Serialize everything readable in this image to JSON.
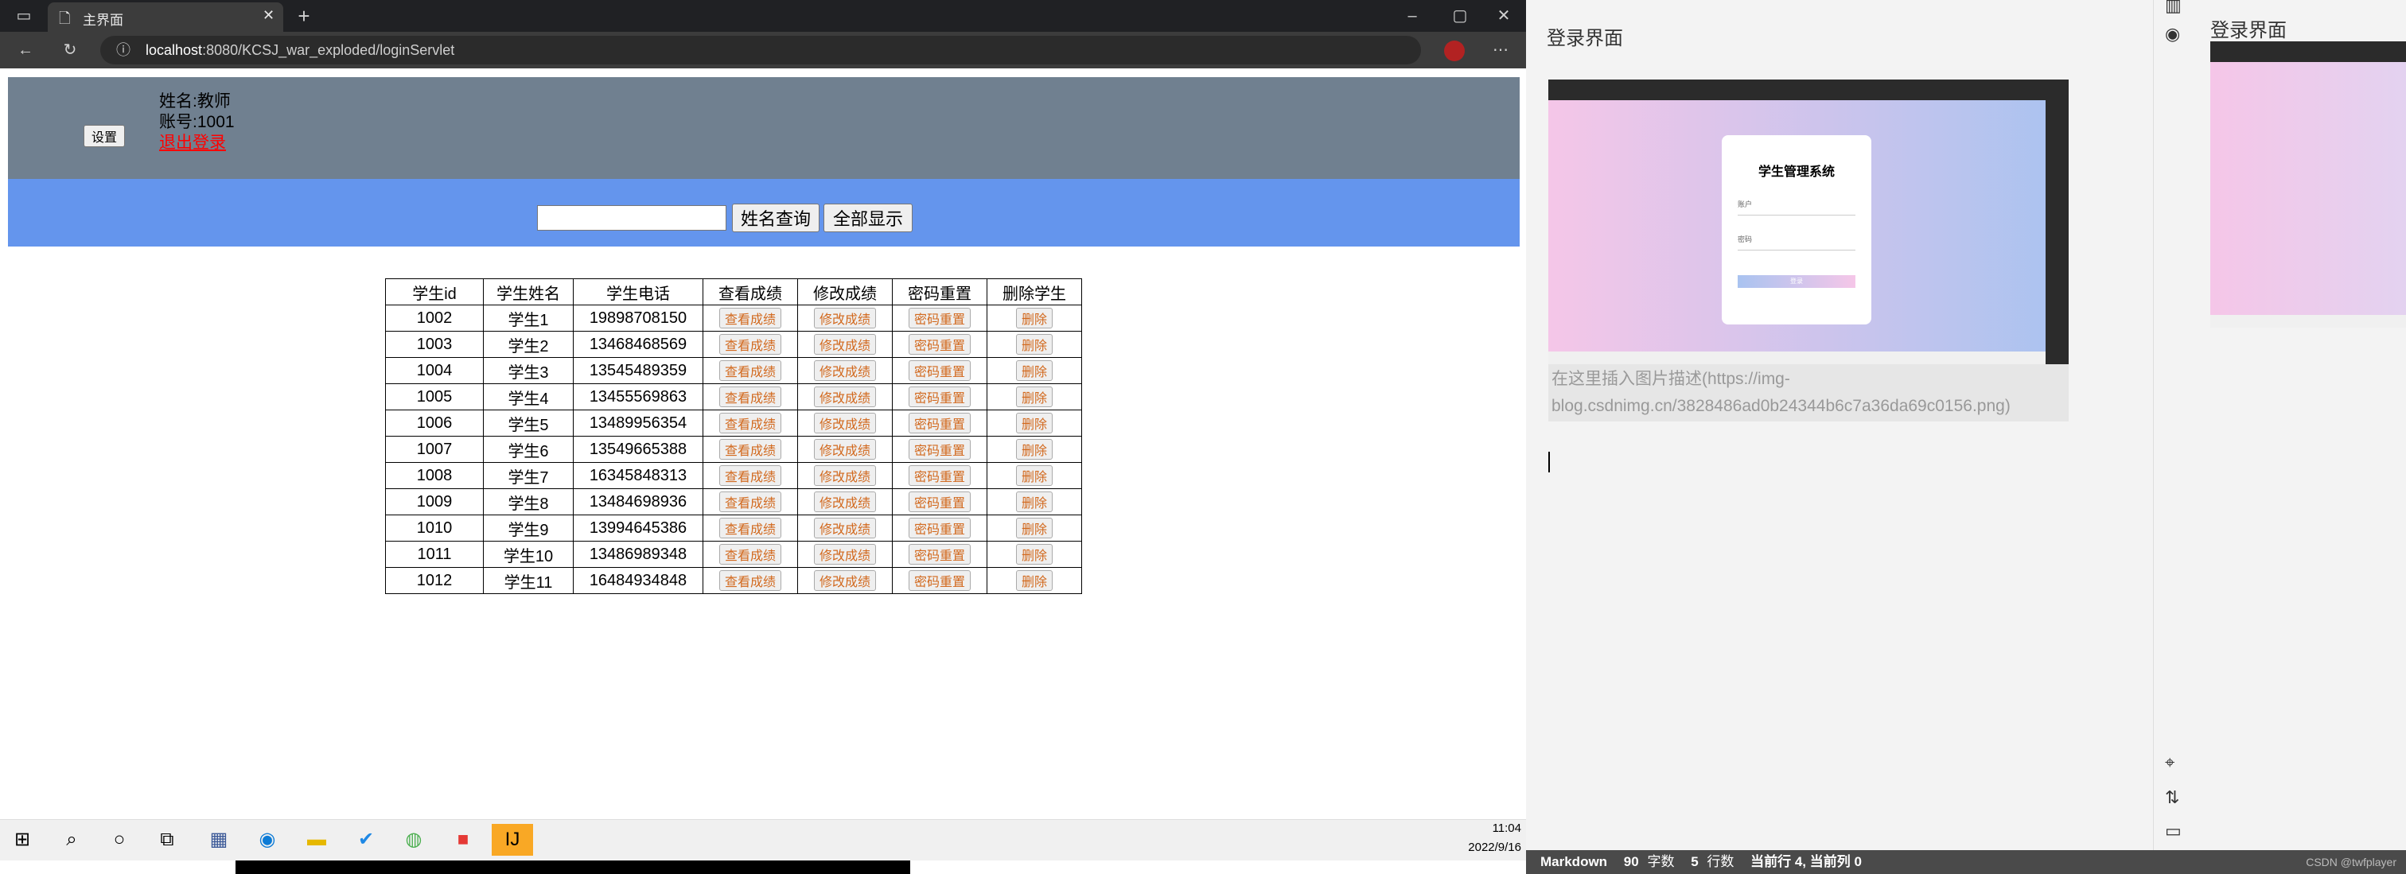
{
  "browser": {
    "tab_title": "主界面",
    "url_host": "localhost",
    "url_rest": ":8080/KCSJ_war_exploded/loginServlet"
  },
  "page": {
    "settings_button": "设置",
    "user_name": "姓名:教师",
    "user_account": "账号:1001",
    "logout_link": "退出登录",
    "search_input_value": "",
    "search_button": "姓名查询",
    "show_all_button": "全部显示",
    "table": {
      "headers": [
        "学生id",
        "学生姓名",
        "学生电话",
        "查看成绩",
        "修改成绩",
        "密码重置",
        "删除学生"
      ],
      "rows": [
        [
          "1002",
          "学生1",
          "19898708150"
        ],
        [
          "1003",
          "学生2",
          "13468468569"
        ],
        [
          "1004",
          "学生3",
          "13545489359"
        ],
        [
          "1005",
          "学生4",
          "13455569863"
        ],
        [
          "1006",
          "学生5",
          "13489956354"
        ],
        [
          "1007",
          "学生6",
          "13549665388"
        ],
        [
          "1008",
          "学生7",
          "16345848313"
        ],
        [
          "1009",
          "学生8",
          "13484698936"
        ],
        [
          "1010",
          "学生9",
          "13994645386"
        ],
        [
          "1011",
          "学生10",
          "13486989348"
        ],
        [
          "1012",
          "学生11",
          "16484934848"
        ]
      ],
      "action_view": "查看成绩",
      "action_edit": "修改成绩",
      "action_reset": "密码重置",
      "action_delete": "删除"
    }
  },
  "taskbar": {
    "time": "11:04",
    "date": "2022/9/16"
  },
  "editor": {
    "heading": "登录界面",
    "screenshot_title": "学生管理系统",
    "screenshot_field1": "账户",
    "screenshot_field2": "密码",
    "screenshot_button": "登录",
    "image_alt_text": "在这里插入图片描述(https://img-blog.csdnimg.cn/3828486ad0b24344b6c7a36da69c0156.png)"
  },
  "preview": {
    "heading": "登录界面"
  },
  "statusbar": {
    "mode": "Markdown",
    "char_count": "90",
    "char_unit": "字数",
    "line_count": "5",
    "line_unit": "行数",
    "cursor": "当前行 4, 当前列 0",
    "watermark": "CSDN @twfplayer"
  },
  "colors": {
    "header_bg": "#708090",
    "search_bg": "#6495ed",
    "logout_link": "#ff0000",
    "action_text": "#d2691e"
  }
}
